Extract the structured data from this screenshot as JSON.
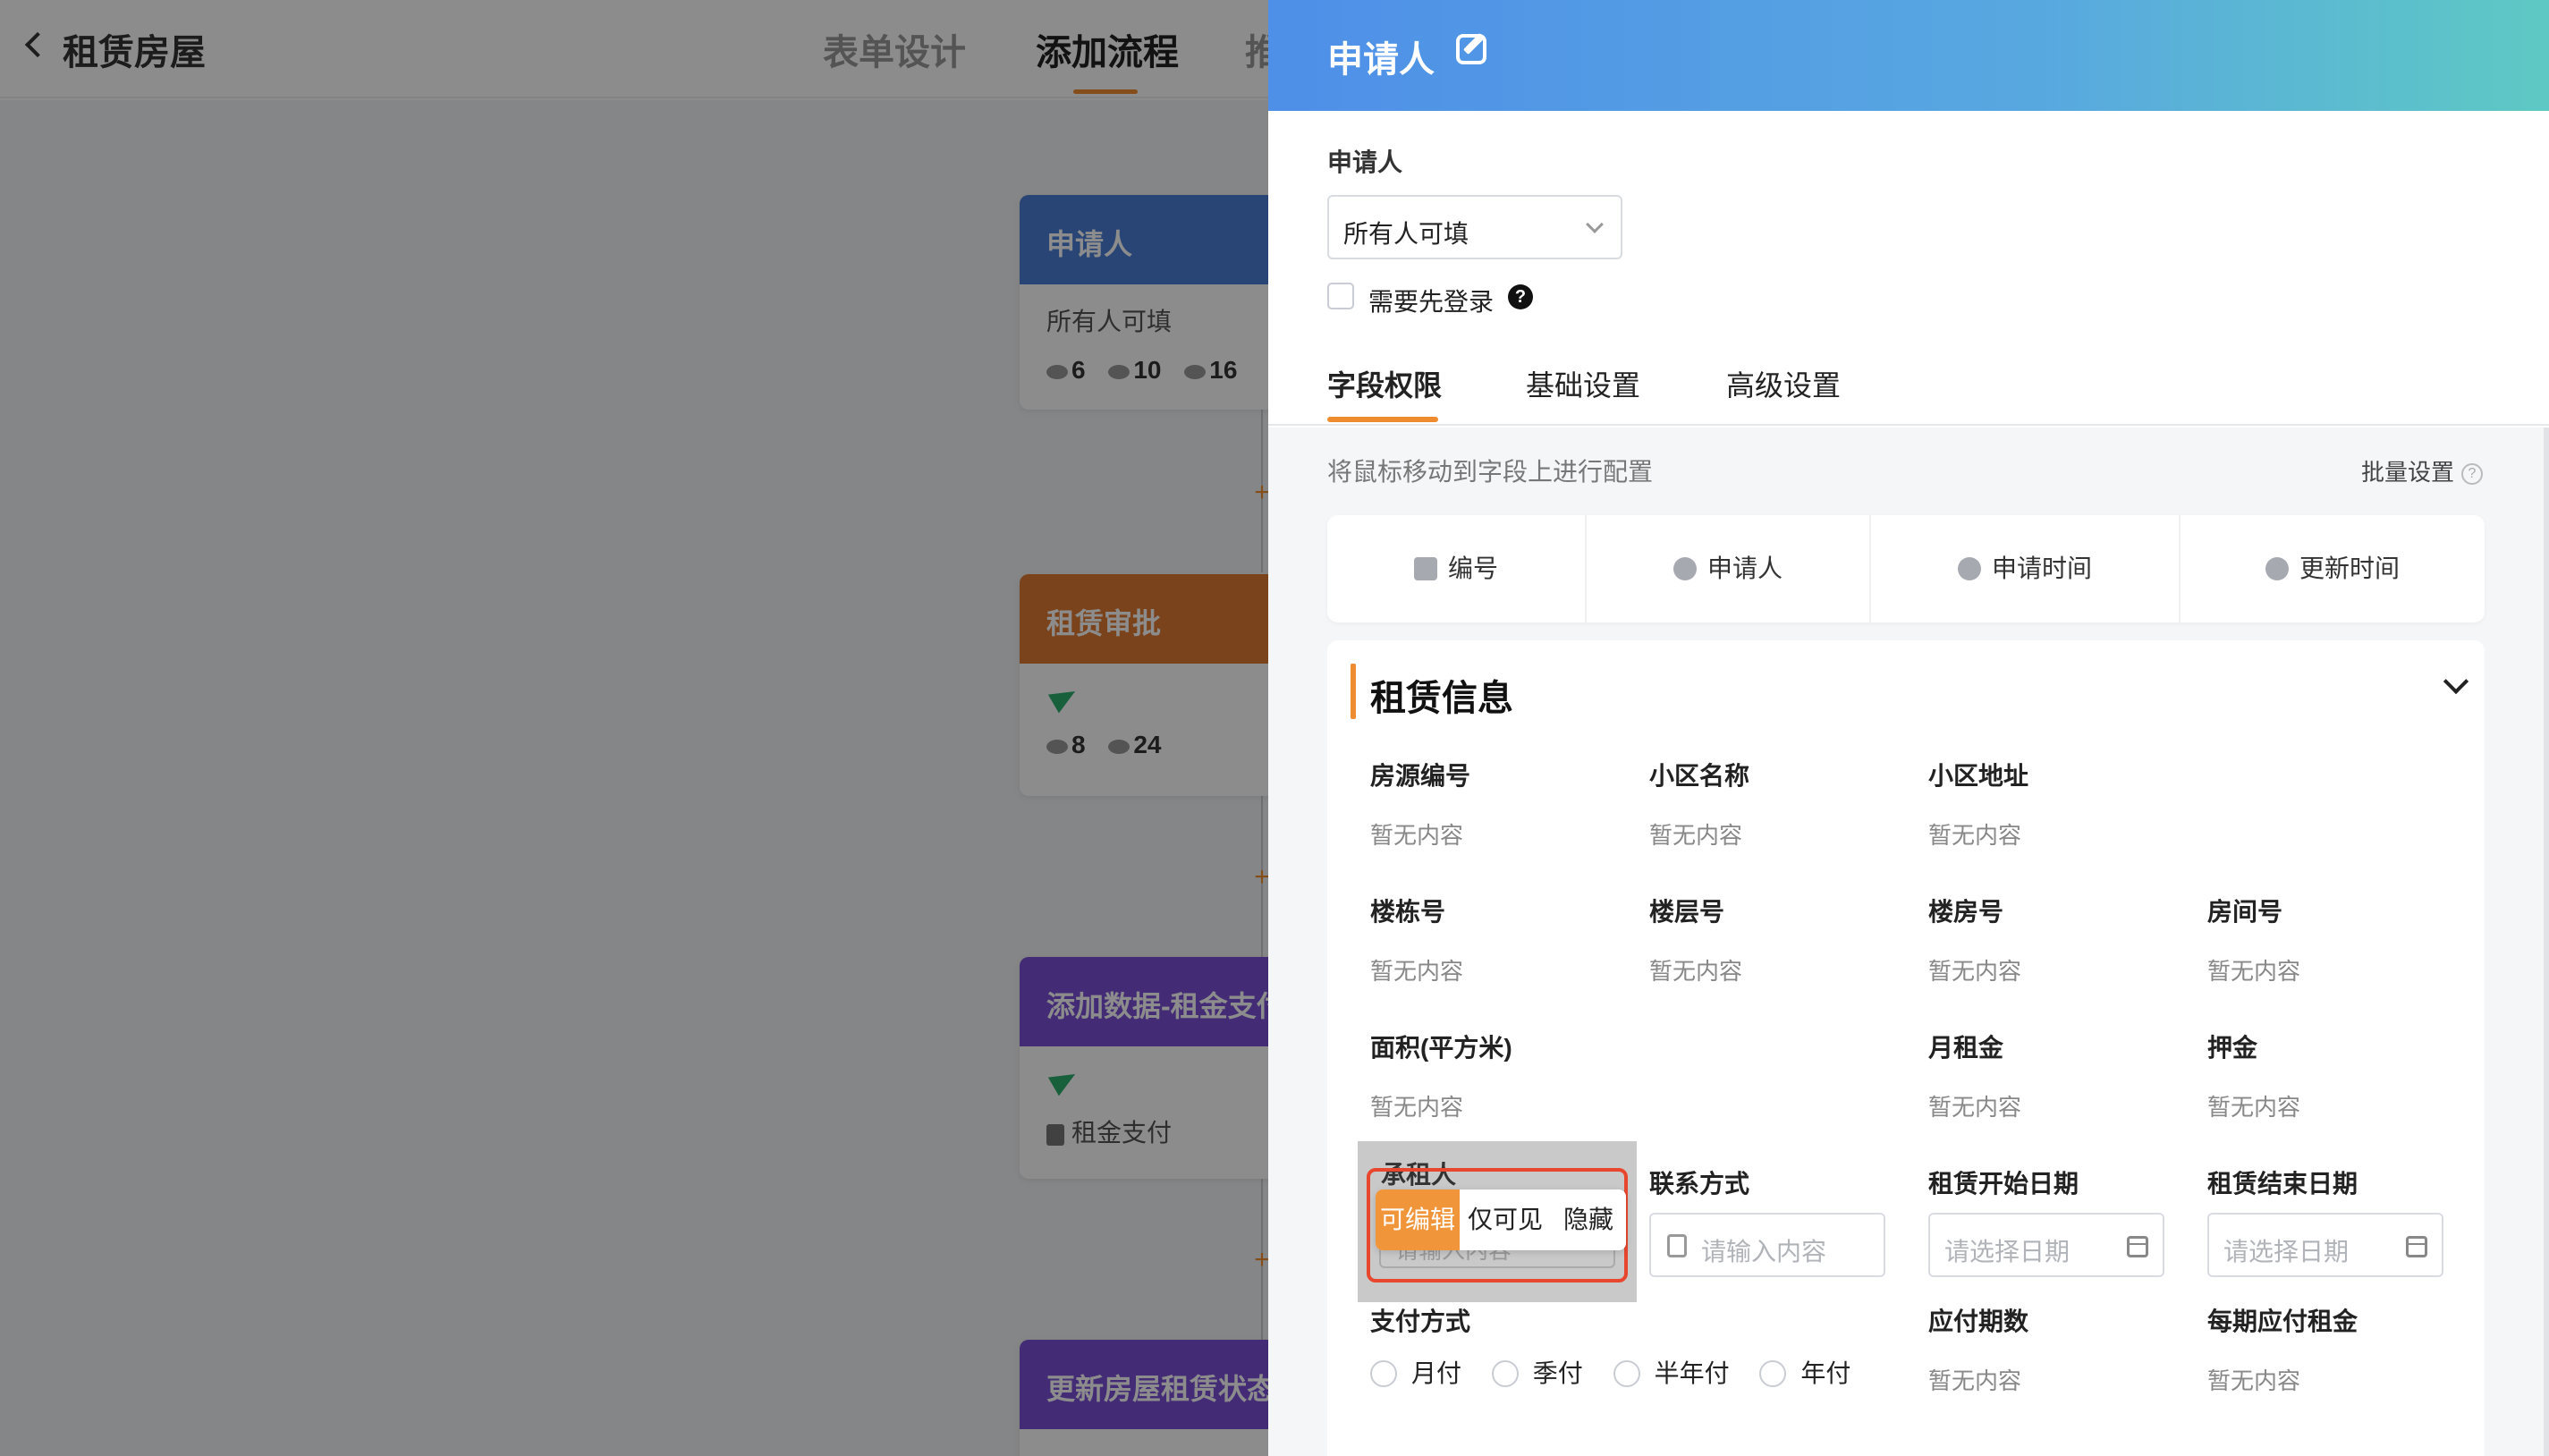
{
  "background": {
    "page_title": "租赁房屋",
    "tabs": [
      "表单设计",
      "添加流程",
      "推"
    ],
    "active_tab": "添加流程",
    "flow_nodes": [
      {
        "title": "申请人",
        "color": "#4a7fd6",
        "subtitle": "所有人可填",
        "stats": [
          "6",
          "10",
          "16"
        ]
      },
      {
        "title": "租赁审批",
        "color": "#e07a32",
        "stats": [
          "8",
          "24"
        ]
      },
      {
        "title": "添加数据-租金支付",
        "color": "#7b4fd8",
        "detail": "租金支付"
      },
      {
        "title": "更新房屋租赁状态",
        "color": "#7b4fd8"
      }
    ],
    "plus": "+"
  },
  "drawer": {
    "title": "申请人",
    "applicant_label": "申请人",
    "fill_scope": "所有人可填",
    "login_required_label": "需要先登录",
    "help": "?",
    "tabs": [
      "字段权限",
      "基础设置",
      "高级设置"
    ],
    "active_tab": "字段权限",
    "hint": "将鼠标移动到字段上进行配置",
    "batch_label": "批量设置",
    "batch_help": "?",
    "system_fields": [
      {
        "label": "编号",
        "icon": "id-card-icon"
      },
      {
        "label": "申请人",
        "icon": "person-icon"
      },
      {
        "label": "申请时间",
        "icon": "clock-icon"
      },
      {
        "label": "更新时间",
        "icon": "update-clock-icon"
      }
    ],
    "group": {
      "title": "租赁信息",
      "empty_text": "暂无内容",
      "fields": {
        "house_no": "房源编号",
        "community": "小区名称",
        "address": "小区地址",
        "building": "楼栋号",
        "floor": "楼层号",
        "unit": "楼房号",
        "room": "房间号",
        "area": "面积(平方米)",
        "rent": "月租金",
        "deposit": "押金",
        "tenant": "承租人",
        "contact": "联系方式",
        "start_date": "租赁开始日期",
        "end_date": "租赁结束日期",
        "pay_method": "支付方式",
        "periods": "应付期数",
        "per_rent": "每期应付租金"
      },
      "input_placeholder": "请输入内容",
      "date_placeholder": "请选择日期",
      "pay_options": [
        "月付",
        "季付",
        "半年付",
        "年付"
      ],
      "permission_options": [
        "可编辑",
        "仅可见",
        "隐藏"
      ],
      "permission_selected": "可编辑",
      "accent": "#f08c30"
    }
  }
}
